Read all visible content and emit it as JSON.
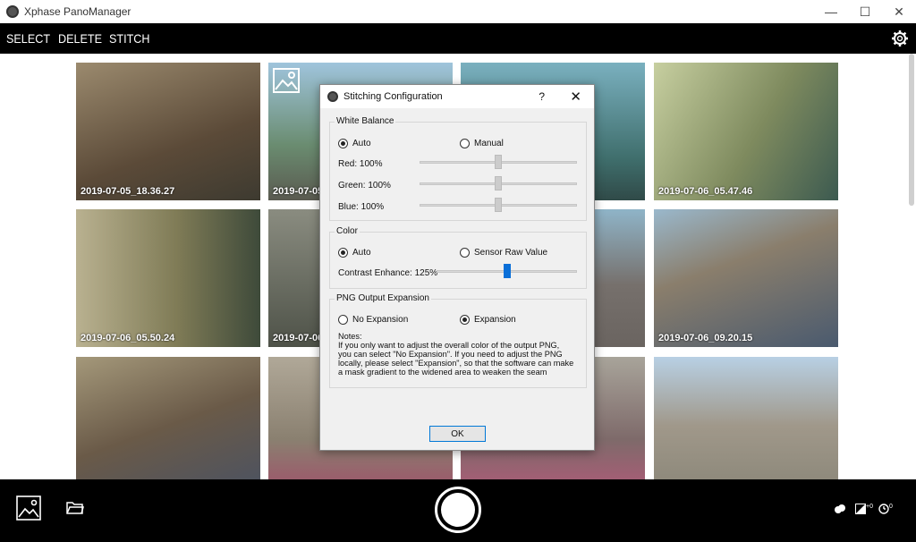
{
  "window": {
    "title": "Xphase PanoManager",
    "minimize": "—",
    "maximize": "☐",
    "close": "✕"
  },
  "toolbar": {
    "select": "SELECT",
    "delete": "DELETE",
    "stitch": "STITCH",
    "settings_icon": "gear-icon"
  },
  "gallery": {
    "thumbnails": [
      {
        "caption": "2019-07-05_18.36.27",
        "color": "#6b5a45"
      },
      {
        "caption": "2019-07-05",
        "color": "#6f8aa0"
      },
      {
        "caption": "",
        "color": "#5b7d86"
      },
      {
        "caption": "2019-07-06_05.47.46",
        "color": "#8c9068"
      },
      {
        "caption": "2019-07-06_05.50.24",
        "color": "#5e6a4c"
      },
      {
        "caption": "2019-07-06",
        "color": "#605a55"
      },
      {
        "caption": "",
        "color": "#6a6470"
      },
      {
        "caption": "2019-07-06_09.20.15",
        "color": "#7a7464"
      },
      {
        "caption": "",
        "color": "#6e6458"
      },
      {
        "caption": "",
        "color": "#8a8278"
      },
      {
        "caption": "",
        "color": "#7a6a68"
      },
      {
        "caption": "",
        "color": "#8e8a7e"
      }
    ]
  },
  "bottom": {
    "gallery_icon": "image-icon",
    "folder_icon": "folder-icon",
    "shutter_icon": "shutter-button",
    "status": {
      "exposure": "+0",
      "timer": "0"
    }
  },
  "dialog": {
    "title": "Stitching Configuration",
    "help": "?",
    "close": "✕",
    "white_balance": {
      "label": "White Balance",
      "auto": "Auto",
      "manual": "Manual",
      "selected": "Auto",
      "red": "Red: 100%",
      "green": "Green: 100%",
      "blue": "Blue: 100%"
    },
    "color": {
      "label": "Color",
      "auto": "Auto",
      "sensor_raw": "Sensor Raw Value",
      "selected": "Auto",
      "contrast": "Contrast Enhance: 125%"
    },
    "png": {
      "label": "PNG Output Expansion",
      "no_expansion": "No Expansion",
      "expansion": "Expansion",
      "selected": "Expansion",
      "notes_title": "Notes:",
      "notes_1": "If you only want to adjust the overall color of the output PNG,",
      "notes_2": "you can select \"No Expansion\". If you need to adjust the PNG",
      "notes_3": "locally, please select \"Expansion\", so that the software can make",
      "notes_4": "a mask gradient to the widened area to weaken the seam"
    },
    "ok": "OK"
  }
}
